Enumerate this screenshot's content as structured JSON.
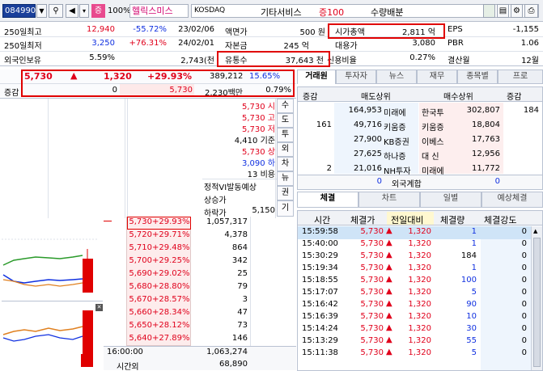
{
  "toolbar": {
    "code": "084990",
    "badge": "증",
    "pct": "100%",
    "name": "헬릭스미스",
    "market": "KOSDAQ",
    "sector": "기타서비스",
    "deposit": "증100",
    "event": "수량배분"
  },
  "info": [
    [
      "250일최고",
      "12,940",
      "-55.72%",
      "23/02/06",
      "액면가",
      "500 원",
      "시가총액",
      "2,811 억",
      "EPS",
      "-1,155"
    ],
    [
      "250일최저",
      "3,250",
      "+76.31%",
      "24/02/01",
      "자본금",
      "245 억",
      "대용가",
      "3,080",
      "PBR",
      "1.06"
    ],
    [
      "외국인보유",
      "5.59%",
      "",
      "2,743(천",
      "유통수",
      "37,643 천",
      "신용비율",
      "0.27%",
      "결산월",
      "12월"
    ]
  ],
  "price": {
    "current": "5,730",
    "arrow": "▲",
    "change": "1,320",
    "pct": "+29.93%",
    "volume": "389,212",
    "vol_pct": "15.65%"
  },
  "sub": {
    "label": "증감",
    "value": "0",
    "price": "5,730",
    "amount": "2,230백만",
    "ratio": "0.79%"
  },
  "summary": [
    {
      "p": "5,730",
      "l": "시"
    },
    {
      "p": "5,730",
      "l": "고"
    },
    {
      "p": "5,730",
      "l": "저"
    },
    {
      "p": "4,410",
      "l": "기준"
    },
    {
      "p": "5,730",
      "l": "상"
    },
    {
      "p": "3,090",
      "l": "하"
    },
    {
      "p": "13",
      "l": "비용"
    }
  ],
  "vtabs": [
    "수",
    "도",
    "투",
    "외",
    "차",
    "뉴",
    "권",
    "기"
  ],
  "expect": {
    "title": "정적VI발동예상",
    "up": "상승가",
    "down": "하락가",
    "down_val": "5,150"
  },
  "orderbook": [
    {
      "p": "5,730",
      "c": "+29.93%",
      "q": "1,057,317",
      "cur": true
    },
    {
      "p": "5,720",
      "c": "+29.71%",
      "q": "4,378"
    },
    {
      "p": "5,710",
      "c": "+29.48%",
      "q": "864"
    },
    {
      "p": "5,700",
      "c": "+29.25%",
      "q": "342"
    },
    {
      "p": "5,690",
      "c": "+29.02%",
      "q": "25"
    },
    {
      "p": "5,680",
      "c": "+28.80%",
      "q": "79"
    },
    {
      "p": "5,670",
      "c": "+28.57%",
      "q": "3"
    },
    {
      "p": "5,660",
      "c": "+28.34%",
      "q": "47"
    },
    {
      "p": "5,650",
      "c": "+28.12%",
      "q": "73"
    },
    {
      "p": "5,640",
      "c": "+27.89%",
      "q": "146"
    }
  ],
  "ob_total": {
    "time": "16:00:00",
    "qty": "1,063,274",
    "label": "시간외",
    "after": "68,890"
  },
  "rtabs": [
    "거래원",
    "투자자",
    "뉴스",
    "재무",
    "종목별",
    "프로"
  ],
  "broker": {
    "h1": "증감",
    "h2": "매도상위",
    "h3": "매수상위",
    "h4": "증감",
    "rows": [
      {
        "d": "",
        "sq": "164,953",
        "sn": "미래에",
        "bn": "한국투",
        "bq": "302,807",
        "bd": "184"
      },
      {
        "d": "161",
        "sq": "49,716",
        "sn": "키움증",
        "bn": "키움증",
        "bq": "18,804",
        "bd": ""
      },
      {
        "d": "",
        "sq": "27,900",
        "sn": "KB증권",
        "bn": "이베스",
        "bq": "17,763",
        "bd": ""
      },
      {
        "d": "",
        "sq": "27,625",
        "sn": "하나증",
        "bn": "대 신",
        "bq": "12,956",
        "bd": ""
      },
      {
        "d": "2",
        "sq": "21,016",
        "sn": "NH투자",
        "bn": "미래에",
        "bq": "11,772",
        "bd": ""
      }
    ],
    "foreign": {
      "d": "0",
      "label": "외국계합",
      "bd": "0"
    }
  },
  "ctabs": [
    "체결",
    "차트",
    "일별",
    "예상체결"
  ],
  "trades": {
    "headers": [
      "시간",
      "체결가",
      "전일대비",
      "체결량",
      "체결강도"
    ],
    "rows": [
      {
        "t": "15:59:58",
        "p": "5,730",
        "c": "1,320",
        "q": "1",
        "s": "0"
      },
      {
        "t": "15:40:00",
        "p": "5,730",
        "c": "1,320",
        "q": "1",
        "s": "0"
      },
      {
        "t": "15:30:29",
        "p": "5,730",
        "c": "1,320",
        "q": "184",
        "s": "0"
      },
      {
        "t": "15:19:34",
        "p": "5,730",
        "c": "1,320",
        "q": "1",
        "s": "0"
      },
      {
        "t": "15:18:55",
        "p": "5,730",
        "c": "1,320",
        "q": "100",
        "s": "0"
      },
      {
        "t": "15:17:07",
        "p": "5,730",
        "c": "1,320",
        "q": "5",
        "s": "0"
      },
      {
        "t": "15:16:42",
        "p": "5,730",
        "c": "1,320",
        "q": "90",
        "s": "0"
      },
      {
        "t": "15:16:39",
        "p": "5,730",
        "c": "1,320",
        "q": "10",
        "s": "0"
      },
      {
        "t": "15:14:24",
        "p": "5,730",
        "c": "1,320",
        "q": "30",
        "s": "0"
      },
      {
        "t": "15:13:29",
        "p": "5,730",
        "c": "1,320",
        "q": "55",
        "s": "0"
      },
      {
        "t": "15:11:38",
        "p": "5,730",
        "c": "1,320",
        "q": "5",
        "s": "0"
      }
    ]
  }
}
